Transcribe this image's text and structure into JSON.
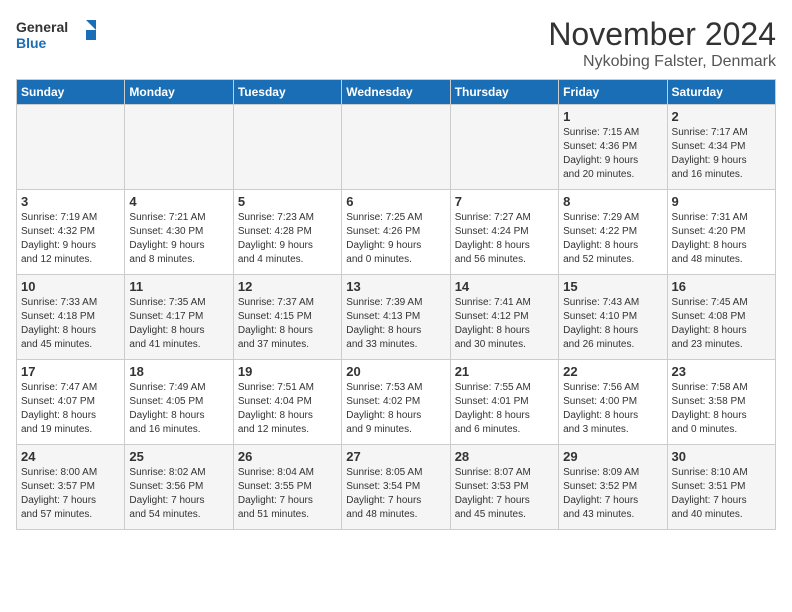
{
  "logo": {
    "line1": "General",
    "line2": "Blue"
  },
  "title": "November 2024",
  "location": "Nykobing Falster, Denmark",
  "days_of_week": [
    "Sunday",
    "Monday",
    "Tuesday",
    "Wednesday",
    "Thursday",
    "Friday",
    "Saturday"
  ],
  "weeks": [
    [
      {
        "day": "",
        "info": ""
      },
      {
        "day": "",
        "info": ""
      },
      {
        "day": "",
        "info": ""
      },
      {
        "day": "",
        "info": ""
      },
      {
        "day": "",
        "info": ""
      },
      {
        "day": "1",
        "info": "Sunrise: 7:15 AM\nSunset: 4:36 PM\nDaylight: 9 hours\nand 20 minutes."
      },
      {
        "day": "2",
        "info": "Sunrise: 7:17 AM\nSunset: 4:34 PM\nDaylight: 9 hours\nand 16 minutes."
      }
    ],
    [
      {
        "day": "3",
        "info": "Sunrise: 7:19 AM\nSunset: 4:32 PM\nDaylight: 9 hours\nand 12 minutes."
      },
      {
        "day": "4",
        "info": "Sunrise: 7:21 AM\nSunset: 4:30 PM\nDaylight: 9 hours\nand 8 minutes."
      },
      {
        "day": "5",
        "info": "Sunrise: 7:23 AM\nSunset: 4:28 PM\nDaylight: 9 hours\nand 4 minutes."
      },
      {
        "day": "6",
        "info": "Sunrise: 7:25 AM\nSunset: 4:26 PM\nDaylight: 9 hours\nand 0 minutes."
      },
      {
        "day": "7",
        "info": "Sunrise: 7:27 AM\nSunset: 4:24 PM\nDaylight: 8 hours\nand 56 minutes."
      },
      {
        "day": "8",
        "info": "Sunrise: 7:29 AM\nSunset: 4:22 PM\nDaylight: 8 hours\nand 52 minutes."
      },
      {
        "day": "9",
        "info": "Sunrise: 7:31 AM\nSunset: 4:20 PM\nDaylight: 8 hours\nand 48 minutes."
      }
    ],
    [
      {
        "day": "10",
        "info": "Sunrise: 7:33 AM\nSunset: 4:18 PM\nDaylight: 8 hours\nand 45 minutes."
      },
      {
        "day": "11",
        "info": "Sunrise: 7:35 AM\nSunset: 4:17 PM\nDaylight: 8 hours\nand 41 minutes."
      },
      {
        "day": "12",
        "info": "Sunrise: 7:37 AM\nSunset: 4:15 PM\nDaylight: 8 hours\nand 37 minutes."
      },
      {
        "day": "13",
        "info": "Sunrise: 7:39 AM\nSunset: 4:13 PM\nDaylight: 8 hours\nand 33 minutes."
      },
      {
        "day": "14",
        "info": "Sunrise: 7:41 AM\nSunset: 4:12 PM\nDaylight: 8 hours\nand 30 minutes."
      },
      {
        "day": "15",
        "info": "Sunrise: 7:43 AM\nSunset: 4:10 PM\nDaylight: 8 hours\nand 26 minutes."
      },
      {
        "day": "16",
        "info": "Sunrise: 7:45 AM\nSunset: 4:08 PM\nDaylight: 8 hours\nand 23 minutes."
      }
    ],
    [
      {
        "day": "17",
        "info": "Sunrise: 7:47 AM\nSunset: 4:07 PM\nDaylight: 8 hours\nand 19 minutes."
      },
      {
        "day": "18",
        "info": "Sunrise: 7:49 AM\nSunset: 4:05 PM\nDaylight: 8 hours\nand 16 minutes."
      },
      {
        "day": "19",
        "info": "Sunrise: 7:51 AM\nSunset: 4:04 PM\nDaylight: 8 hours\nand 12 minutes."
      },
      {
        "day": "20",
        "info": "Sunrise: 7:53 AM\nSunset: 4:02 PM\nDaylight: 8 hours\nand 9 minutes."
      },
      {
        "day": "21",
        "info": "Sunrise: 7:55 AM\nSunset: 4:01 PM\nDaylight: 8 hours\nand 6 minutes."
      },
      {
        "day": "22",
        "info": "Sunrise: 7:56 AM\nSunset: 4:00 PM\nDaylight: 8 hours\nand 3 minutes."
      },
      {
        "day": "23",
        "info": "Sunrise: 7:58 AM\nSunset: 3:58 PM\nDaylight: 8 hours\nand 0 minutes."
      }
    ],
    [
      {
        "day": "24",
        "info": "Sunrise: 8:00 AM\nSunset: 3:57 PM\nDaylight: 7 hours\nand 57 minutes."
      },
      {
        "day": "25",
        "info": "Sunrise: 8:02 AM\nSunset: 3:56 PM\nDaylight: 7 hours\nand 54 minutes."
      },
      {
        "day": "26",
        "info": "Sunrise: 8:04 AM\nSunset: 3:55 PM\nDaylight: 7 hours\nand 51 minutes."
      },
      {
        "day": "27",
        "info": "Sunrise: 8:05 AM\nSunset: 3:54 PM\nDaylight: 7 hours\nand 48 minutes."
      },
      {
        "day": "28",
        "info": "Sunrise: 8:07 AM\nSunset: 3:53 PM\nDaylight: 7 hours\nand 45 minutes."
      },
      {
        "day": "29",
        "info": "Sunrise: 8:09 AM\nSunset: 3:52 PM\nDaylight: 7 hours\nand 43 minutes."
      },
      {
        "day": "30",
        "info": "Sunrise: 8:10 AM\nSunset: 3:51 PM\nDaylight: 7 hours\nand 40 minutes."
      }
    ]
  ]
}
